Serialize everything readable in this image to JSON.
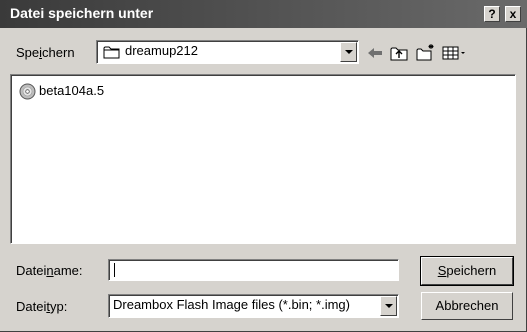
{
  "window": {
    "title": "Datei speichern unter",
    "help_label": "?",
    "close_label": "x"
  },
  "save_in": {
    "label_pre": "Spe",
    "label_ul": "i",
    "label_post": "chern",
    "folder": "dreamup212"
  },
  "files": [
    {
      "name": "beta104a.5",
      "icon": "cd-disc-icon"
    }
  ],
  "filename": {
    "label_pre": "Datei",
    "label_ul": "n",
    "label_post": "ame:",
    "value": ""
  },
  "filetype": {
    "label_pre": "Datei",
    "label_ul": "t",
    "label_post": "yp:",
    "selected": "Dreambox Flash Image files (*.bin; *.img)"
  },
  "buttons": {
    "save_ul": "S",
    "save_rest": "peichern",
    "cancel": "Abbrechen"
  },
  "toolbar": {
    "icons": [
      "back-arrow-icon",
      "up-folder-icon",
      "new-folder-icon",
      "view-menu-icon"
    ]
  }
}
